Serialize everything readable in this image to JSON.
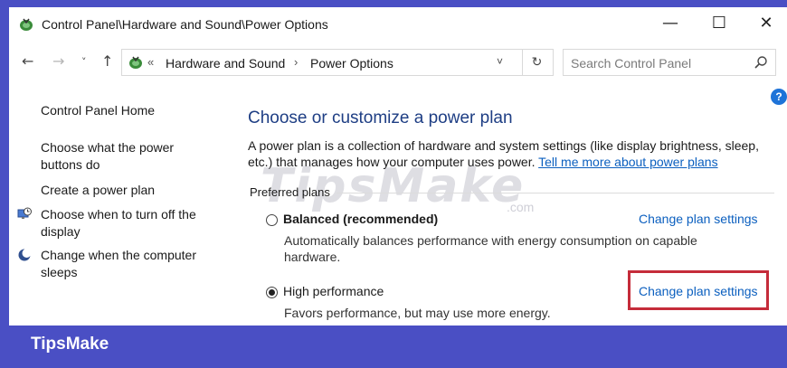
{
  "window": {
    "title": "Control Panel\\Hardware and Sound\\Power Options",
    "controls": {
      "minimize": "—",
      "maximize": "☐",
      "close": "✕"
    }
  },
  "navigation": {
    "back": "←",
    "forward": "→",
    "recent": "˅",
    "up": "↑",
    "breadcrumb_chevron": "«",
    "breadcrumb": [
      "Hardware and Sound",
      "Power Options"
    ],
    "separator": "›",
    "dropdown": "˅",
    "refresh": "↻",
    "search_placeholder": "Search Control Panel"
  },
  "help": "?",
  "sidebar": {
    "items": [
      {
        "label": "Control Panel Home"
      },
      {
        "label": "Choose what the power buttons do"
      },
      {
        "label": "Create a power plan"
      },
      {
        "label": "Choose when to turn off the display",
        "icon": "monitor-clock-icon"
      },
      {
        "label": "Change when the computer sleeps",
        "icon": "moon-icon"
      }
    ]
  },
  "main": {
    "title": "Choose or customize a power plan",
    "description": "A power plan is a collection of hardware and system settings (like display brightness, sleep, etc.) that manages how your computer uses power. ",
    "description_link": "Tell me more about power plans",
    "group_label": "Preferred plans",
    "watermark": "TipsMake",
    "watermark_suffix": ".com",
    "plans": [
      {
        "name": "Balanced (recommended)",
        "description": "Automatically balances performance with energy consumption on capable hardware.",
        "link": "Change plan settings",
        "selected": false
      },
      {
        "name": "High performance",
        "description": "Favors performance, but may use more energy.",
        "link": "Change plan settings",
        "selected": true
      }
    ]
  },
  "footer": {
    "brand": "TipsMake"
  },
  "colors": {
    "frame": "#4a4fc4",
    "title": "#1e3e84",
    "link": "#0b5fbf",
    "highlight_box": "#c52c3a"
  }
}
